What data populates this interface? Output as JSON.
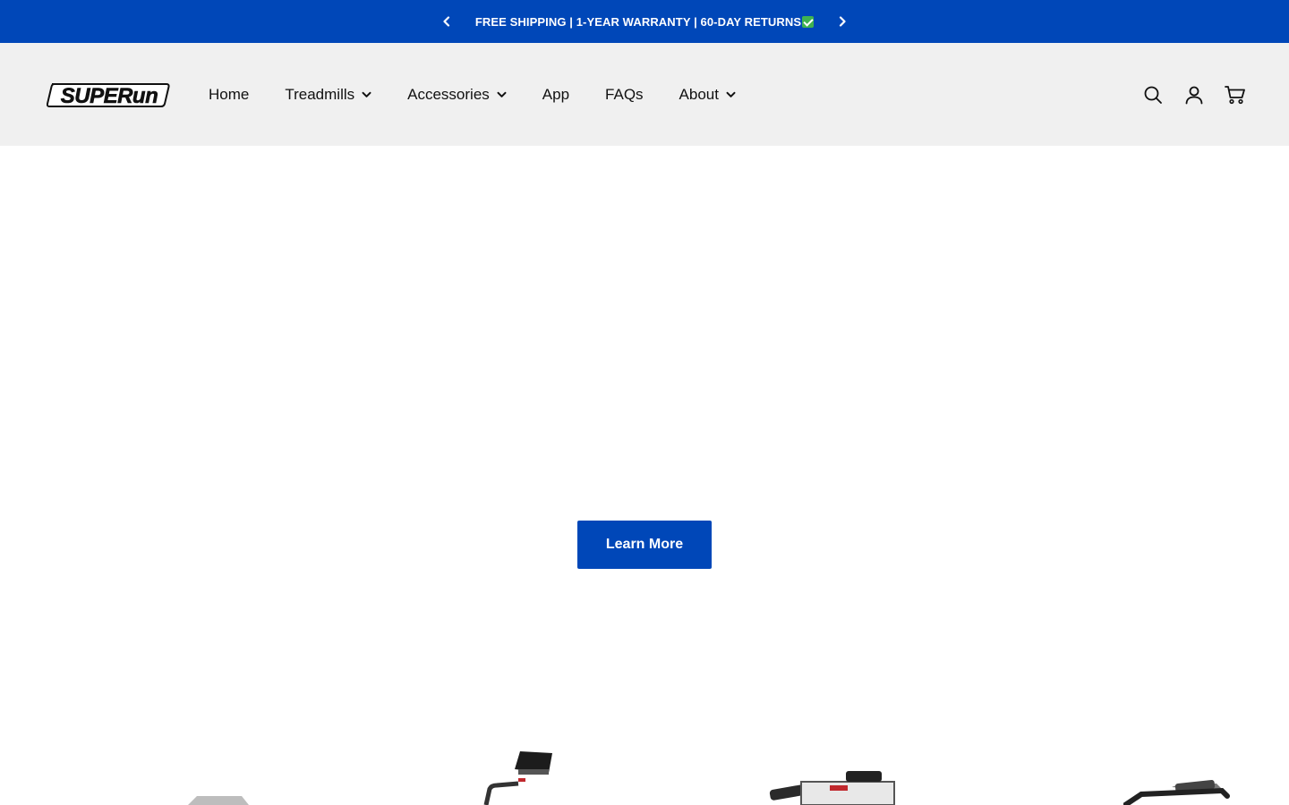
{
  "announcement": {
    "message": "FREE SHIPPING | 1-YEAR WARRANTY | 60-DAY RETURNS",
    "prev_icon": "chevron-left-icon",
    "next_icon": "chevron-right-icon",
    "check_icon": "check-mark-icon"
  },
  "header": {
    "logo_text": "SUPERun",
    "nav": [
      {
        "label": "Home",
        "has_dropdown": false
      },
      {
        "label": "Treadmills",
        "has_dropdown": true
      },
      {
        "label": "Accessories",
        "has_dropdown": true
      },
      {
        "label": "App",
        "has_dropdown": false
      },
      {
        "label": "FAQs",
        "has_dropdown": false
      },
      {
        "label": "About",
        "has_dropdown": true
      }
    ],
    "actions": {
      "search_icon": "search-icon",
      "account_icon": "account-icon",
      "cart_icon": "cart-icon"
    }
  },
  "hero": {
    "cta_label": "Learn More"
  },
  "colors": {
    "brand_blue": "#0047b8",
    "header_bg": "#f0f0f0",
    "text": "#111111"
  }
}
